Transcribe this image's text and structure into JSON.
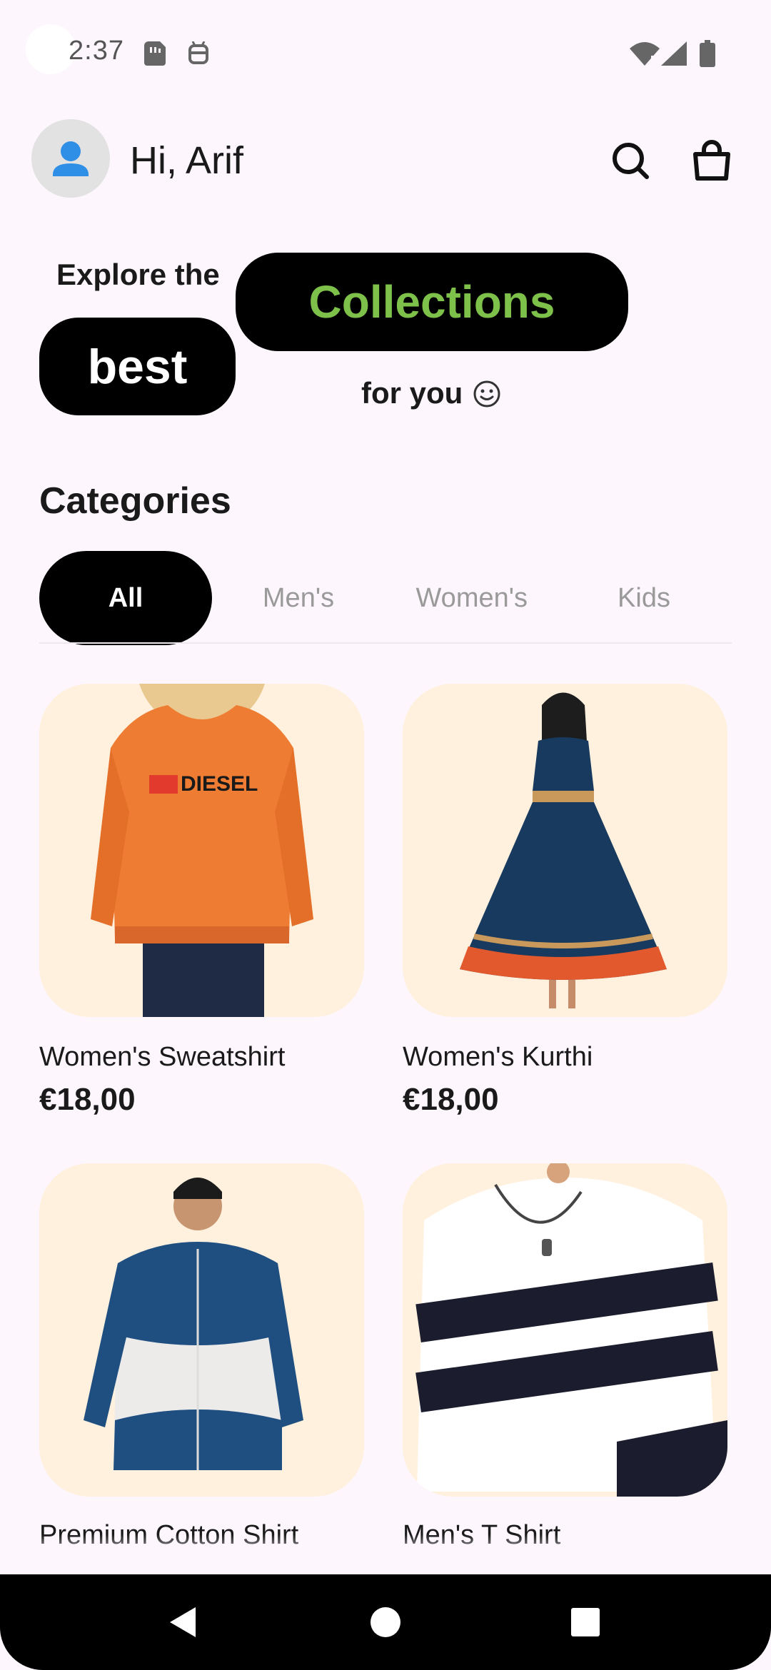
{
  "status_bar": {
    "time": "2:37"
  },
  "header": {
    "greeting": "Hi, Arif"
  },
  "hero": {
    "line1": "Explore the",
    "highlight_green": "Collections",
    "highlight_white": "best",
    "line3": "for you"
  },
  "categories": {
    "title": "Categories",
    "tabs": [
      "All",
      "Men's",
      "Women's",
      "Kids"
    ],
    "selected": "All"
  },
  "products": [
    {
      "name": "Women's Sweatshirt",
      "price": "€18,00"
    },
    {
      "name": "Women's Kurthi",
      "price": "€18,00"
    },
    {
      "name": "Premium Cotton Shirt",
      "price": ""
    },
    {
      "name": "Men's T Shirt",
      "price": ""
    }
  ],
  "colors": {
    "background": "#fdf7fd",
    "accent_green": "#7dc04a",
    "card_bg": "#fff1de",
    "avatar_icon": "#2f8fe6"
  },
  "icons": [
    "avatar-person-icon",
    "search-icon",
    "shopping-bag-icon",
    "smile-icon",
    "back-icon",
    "home-icon",
    "recents-icon"
  ]
}
